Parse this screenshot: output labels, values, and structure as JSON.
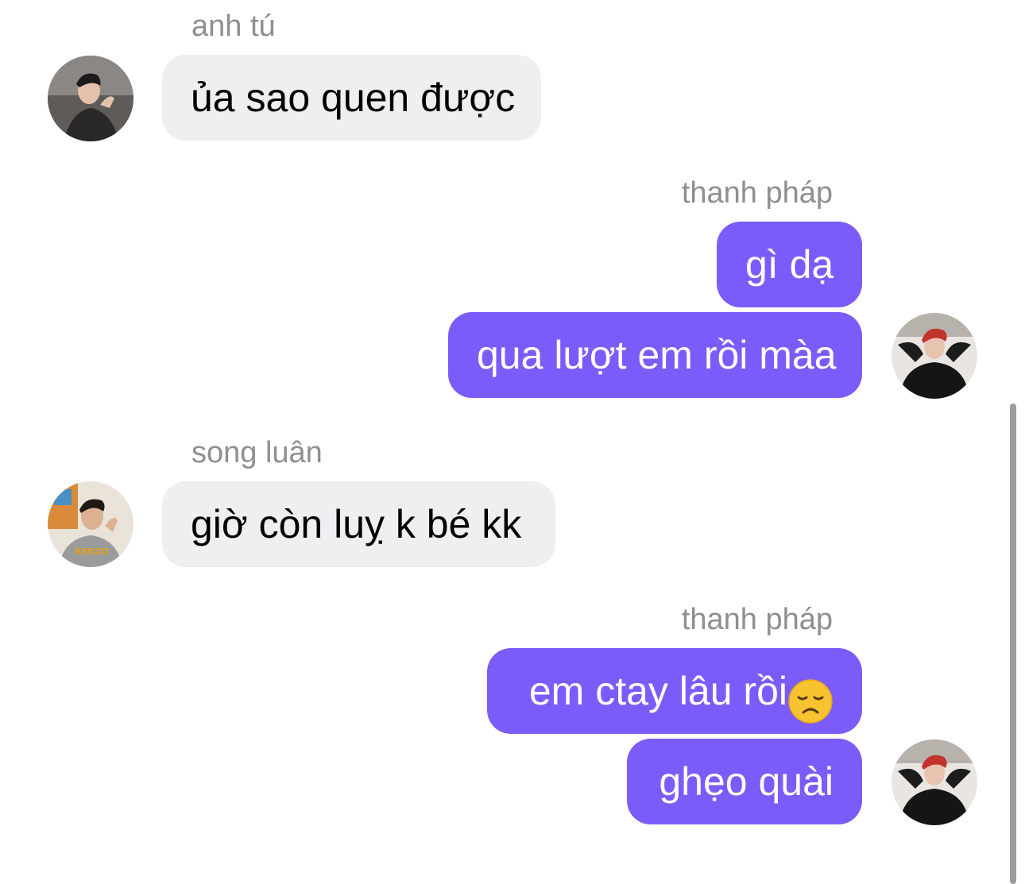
{
  "colors": {
    "incoming_bubble": "#efeff2",
    "outgoing_bubble": "#7b5cfa",
    "sender_text": "#8e8e93"
  },
  "messages": [
    {
      "sender": "anh tú",
      "text": "ủa sao quen được",
      "direction": "incoming"
    },
    {
      "sender": "thanh pháp",
      "text": "gì dạ",
      "direction": "outgoing"
    },
    {
      "sender": "",
      "text": "qua lượt em rồi màa",
      "direction": "outgoing"
    },
    {
      "sender": "song luân",
      "text": "giờ còn luỵ k bé kk",
      "direction": "incoming"
    },
    {
      "sender": "thanh pháp",
      "text": "em ctay lâu rồi",
      "emoji": "disappointed-face-emoji",
      "direction": "outgoing"
    },
    {
      "sender": "",
      "text": "ghẹo quài",
      "direction": "outgoing"
    }
  ]
}
